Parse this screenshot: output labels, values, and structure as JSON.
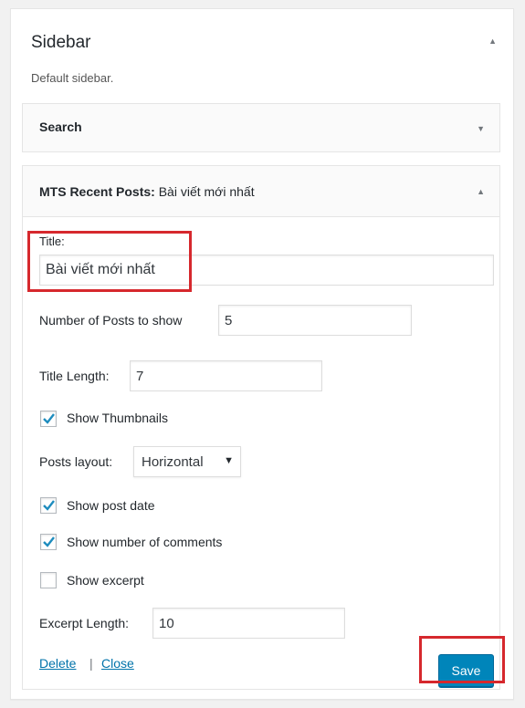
{
  "sidebar": {
    "title": "Sidebar",
    "description": "Default sidebar.",
    "collapse_icon": "arrow-up-icon"
  },
  "search_widget": {
    "title": "Search",
    "toggle_icon": "arrow-down-icon"
  },
  "mts_widget": {
    "title_bold": "MTS Recent Posts:",
    "title_sub": "Bài viết mới nhất",
    "toggle_icon": "arrow-up-icon",
    "fields": {
      "title_label": "Title:",
      "title_value": "Bài viết mới nhất",
      "num_posts_label": "Number of Posts to show",
      "num_posts_value": "5",
      "title_length_label": "Title Length:",
      "title_length_value": "7",
      "show_thumbnails_label": "Show Thumbnails",
      "show_thumbnails_checked": true,
      "posts_layout_label": "Posts layout:",
      "posts_layout_value": "Horizontal",
      "show_post_date_label": "Show post date",
      "show_post_date_checked": true,
      "show_comments_label": "Show number of comments",
      "show_comments_checked": true,
      "show_excerpt_label": "Show excerpt",
      "show_excerpt_checked": false,
      "excerpt_length_label": "Excerpt Length:",
      "excerpt_length_value": "10"
    },
    "actions": {
      "delete_label": "Delete",
      "separator": "|",
      "close_label": "Close",
      "save_label": "Save"
    }
  },
  "colors": {
    "accent": "#0085ba",
    "link": "#0073aa",
    "highlight": "#d6282d",
    "check": "#1e8cbe"
  }
}
